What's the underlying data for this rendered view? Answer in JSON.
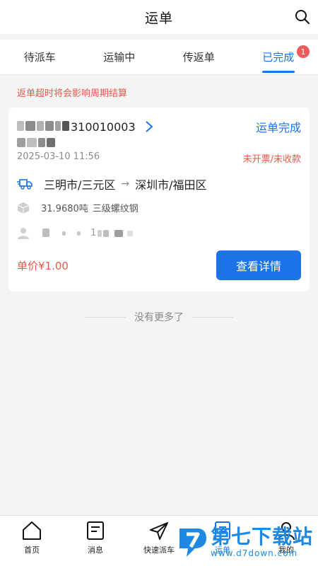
{
  "header": {
    "title": "运单"
  },
  "tabs": [
    {
      "label": "待派车",
      "active": false
    },
    {
      "label": "运输中",
      "active": false
    },
    {
      "label": "传返单",
      "active": false
    },
    {
      "label": "已完成",
      "active": true,
      "badge": "1"
    }
  ],
  "notice": "返单超时将会影响周期结算",
  "order": {
    "waybill_suffix": "310010003",
    "status": "运单完成",
    "date": "2025-03-10 11:56",
    "payment_status": "未开票/未收款",
    "origin": "三明市/三元区",
    "destination": "深圳市/福田区",
    "weight": "31.9680吨",
    "goods": "三级螺纹钢",
    "driver_initial": "1",
    "unit_price": "单价¥1.00",
    "detail_button": "查看详情"
  },
  "list_end_text": "没有更多了",
  "bottom_nav": [
    {
      "label": "首页",
      "icon": "home-icon"
    },
    {
      "label": "消息",
      "icon": "message-icon"
    },
    {
      "label": "快速派车",
      "icon": "send-icon"
    },
    {
      "label": "运单",
      "icon": "waybill-icon"
    },
    {
      "label": "我的",
      "icon": "person-icon"
    }
  ],
  "watermark": {
    "name": "第七下载站",
    "url": "www.d7down.com"
  },
  "colors": {
    "accent": "#1a73e8",
    "alert": "#e45a4a",
    "badge": "#ef5b5b"
  }
}
